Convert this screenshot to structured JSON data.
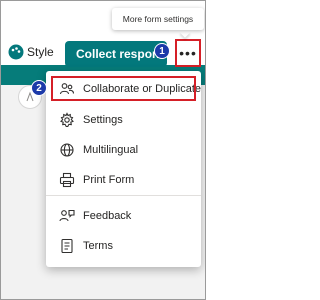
{
  "toolbar": {
    "style_label": "Style",
    "collect_label": "Collect responses",
    "more_icon": "more-horizontal-icon",
    "more_glyph": "•••"
  },
  "tooltip": {
    "text": "More form settings"
  },
  "steps": {
    "one": "1",
    "two": "2"
  },
  "menu": {
    "items": [
      {
        "label": "Collaborate or Duplicate",
        "icon": "people-icon"
      },
      {
        "label": "Settings",
        "icon": "gear-icon"
      },
      {
        "label": "Multilingual",
        "icon": "globe-icon"
      },
      {
        "label": "Print Form",
        "icon": "printer-icon"
      },
      {
        "label": "Feedback",
        "icon": "feedback-icon"
      },
      {
        "label": "Terms",
        "icon": "document-icon"
      }
    ]
  },
  "colors": {
    "brand_teal": "#03787c",
    "highlight_red": "#d51f27",
    "step_badge_blue": "#1c3aa9"
  }
}
